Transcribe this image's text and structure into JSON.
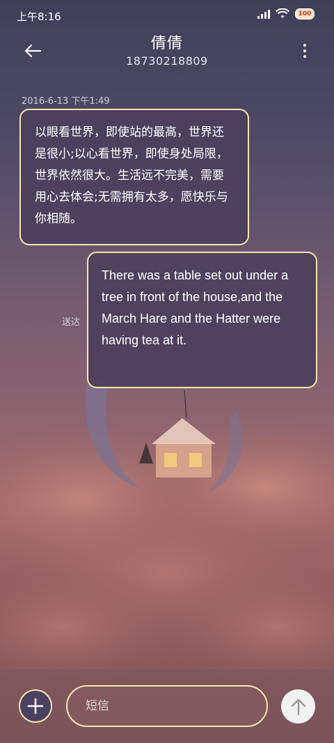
{
  "status_bar": {
    "time": "上午8:16",
    "battery": "100"
  },
  "header": {
    "contact_name": "倩倩",
    "phone_number": "18730218809",
    "back_icon": "arrow-left-icon",
    "more_icon": "more-vertical-icon"
  },
  "conversation": {
    "timestamp": "2016-6-13 下午1:49",
    "messages": [
      {
        "direction": "incoming",
        "text": "以眼看世界，即使站的最高，世界还是很小;以心看世界，即使身处局限，世界依然很大。生活远不完美，需要用心去体会;无需拥有太多，愿快乐与你相随。"
      },
      {
        "direction": "outgoing",
        "text": "There was a table set out under a tree in front of the house,and the March Hare and the Hatter were having tea at it.",
        "status": "送达"
      }
    ]
  },
  "composer": {
    "placeholder": "短信",
    "add_icon": "plus-icon",
    "send_icon": "arrow-up-icon"
  },
  "colors": {
    "bubble_border": "#f4e7b0",
    "bubble_fill": "#4c405c",
    "send_button": "#f2f2f2"
  }
}
